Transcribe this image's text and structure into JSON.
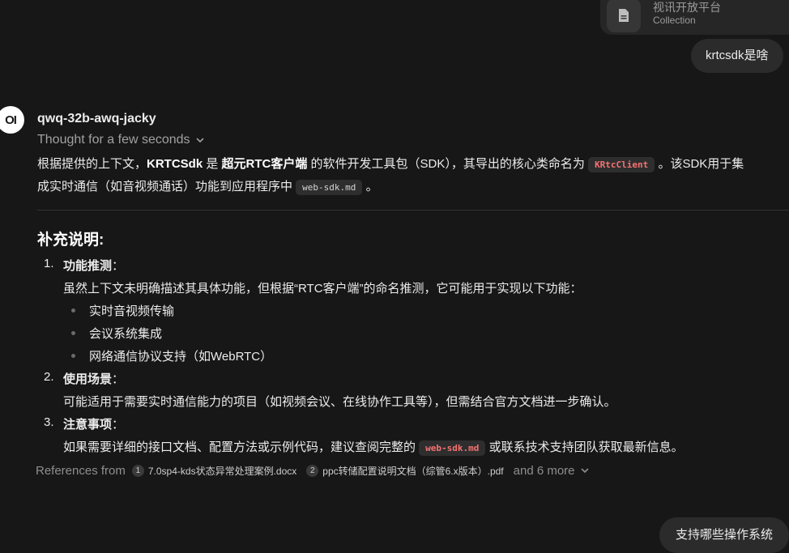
{
  "attachment": {
    "title": "视讯开放平台",
    "type": "Collection",
    "icon": "document-icon"
  },
  "user_messages": [
    "krtcsdk是啥",
    "支持哪些操作系统"
  ],
  "assistant": {
    "avatar_text": "OI",
    "model": "qwq-32b-awq-jacky",
    "thought": "Thought for a few seconds",
    "intro": {
      "p1": "根据提供的上下文，",
      "b1": "KRTCSdk",
      "p2": " 是 ",
      "b2": "超元RTC客户端",
      "p3": " 的软件开发工具包（SDK），其导出的核心类命名为 ",
      "code1": "KRtcClient",
      "p4": " 。该SDK用于集",
      "p5": "成实时通信（如音视频通话）功能到应用程序中 ",
      "code2": "web-sdk.md",
      "p6": " 。"
    },
    "section_title": "补充说明:",
    "items": [
      {
        "num": "1.",
        "title": "功能推测",
        "colon": "：",
        "text": "虽然上下文未明确描述其具体功能，但根据“RTC客户端”的命名推测，它可能用于实现以下功能：",
        "bullets": [
          "实时音视频传输",
          "会议系统集成",
          "网络通信协议支持（如WebRTC）"
        ]
      },
      {
        "num": "2.",
        "title": "使用场景",
        "colon": "：",
        "text": "可能适用于需要实时通信能力的项目（如视频会议、在线协作工具等），但需结合官方文档进一步确认。"
      },
      {
        "num": "3.",
        "title": "注意事项",
        "colon": "：",
        "text_before": "如果需要详细的接口文档、配置方法或示例代码，建议查阅完整的 ",
        "code": "web-sdk.md",
        "text_after": " 或联系技术支持团队获取最新信息。"
      }
    ],
    "references": {
      "label": "References from",
      "files": [
        {
          "n": "1",
          "name": "7.0sp4-kds状态异常处理案例.docx"
        },
        {
          "n": "2",
          "name": "ppc转储配置说明文档（综管6.x版本）.pdf"
        }
      ],
      "more": "and 6 more"
    }
  },
  "colors": {
    "background": "#171717",
    "bubble": "#2b2b2b",
    "code_red": "#f87171",
    "muted": "#8f8f8f"
  }
}
